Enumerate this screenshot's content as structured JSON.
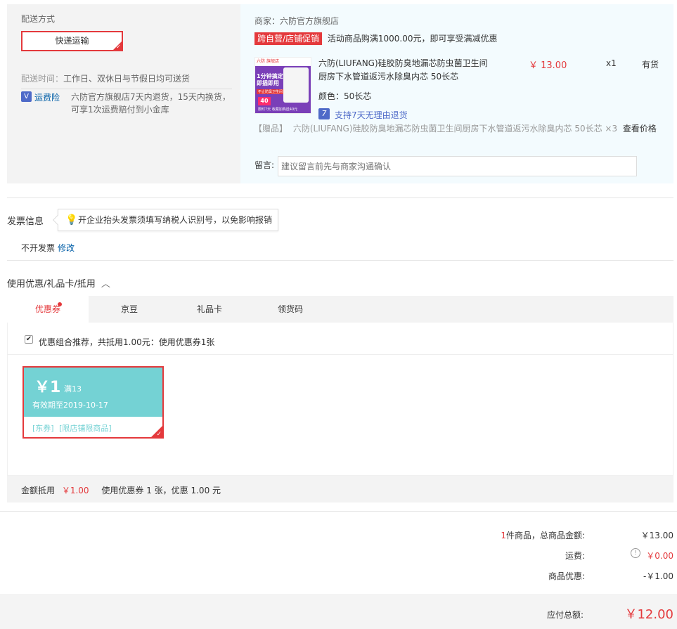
{
  "shipping": {
    "title": "配送方式",
    "method": "快递运输",
    "time_label": "配送时间：",
    "time_value": "工作日、双休日与节假日均可送货",
    "insurance_label": "运费险",
    "insurance_line1": "六防官方旗舰店7天内退货，15天内换货，",
    "insurance_line2": "可享1次运费赔付到小金库"
  },
  "shop": {
    "merchant_label": "商家：",
    "merchant_name": "六防官方旗舰店",
    "promo_tag": "跨自营/店铺促销",
    "promo_text": "活动商品购满1000.00元，即可享受满减优惠",
    "product": {
      "name_line1": "六防(LIUFANG)硅胶防臭地漏芯防虫菌卫生间",
      "name_line2": "厨房下水管道返污水除臭内芯 50长芯",
      "price": "￥ 13.00",
      "qty": "x1",
      "stock": "有货",
      "color": "颜色：50长芯",
      "return_badge": "7",
      "return_text": "支持7天无理由退货",
      "thumb_brand": "六防",
      "thumb_store": "旗舰店",
      "thumb_line1": "1分钟搞定",
      "thumb_line2": "即插即用",
      "thumb_sub": "不止防臭卫生间",
      "thumb_badge": "40",
      "thumb_bottom": "限时7天",
      "thumb_bottom2": "收藏加购送40元"
    },
    "gift_label": "【赠品】",
    "gift_text": "六防(LIUFANG)硅胶防臭地漏芯防虫菌卫生间厨房下水管道返污水除臭内芯 50长芯 ×3",
    "gift_link": "查看价格",
    "message_label": "留言:",
    "message_placeholder": "建议留言前先与商家沟通确认"
  },
  "invoice": {
    "title": "发票信息",
    "tip": "开企业抬头发票须填写纳税人识别号，以免影响报销",
    "status": "不开发票",
    "edit": "修改"
  },
  "discount": {
    "title": "使用优惠/礼品卡/抵用",
    "tabs": [
      {
        "label": "优惠券"
      },
      {
        "label": "京豆"
      },
      {
        "label": "礼品卡"
      },
      {
        "label": "领货码"
      }
    ],
    "recommend_text": "优惠组合推荐，共抵用1.00元：使用优惠券1张",
    "coupon": {
      "amount": "￥1",
      "condition": "满13",
      "expiry": "有效期至2019-10-17",
      "tag1": "[东券]",
      "tag2": "[限店铺限商品]"
    },
    "summary_label": "金额抵用",
    "summary_amount": "￥1.00",
    "summary_text": "使用优惠券 1 张，优惠 1.00 元"
  },
  "totals": {
    "count": "1",
    "count_suffix": "件商品，总商品金额:",
    "goods_amount": "￥13.00",
    "freight_label": "运费:",
    "freight_value": "￥0.00",
    "discount_label": "商品优惠:",
    "discount_value": "-￥1.00",
    "payable_label": "应付总额:",
    "payable_value": "￥12.00"
  },
  "colors": {
    "accent": "#e4393c",
    "link": "#005ea7",
    "coupon": "#74d2d4"
  }
}
